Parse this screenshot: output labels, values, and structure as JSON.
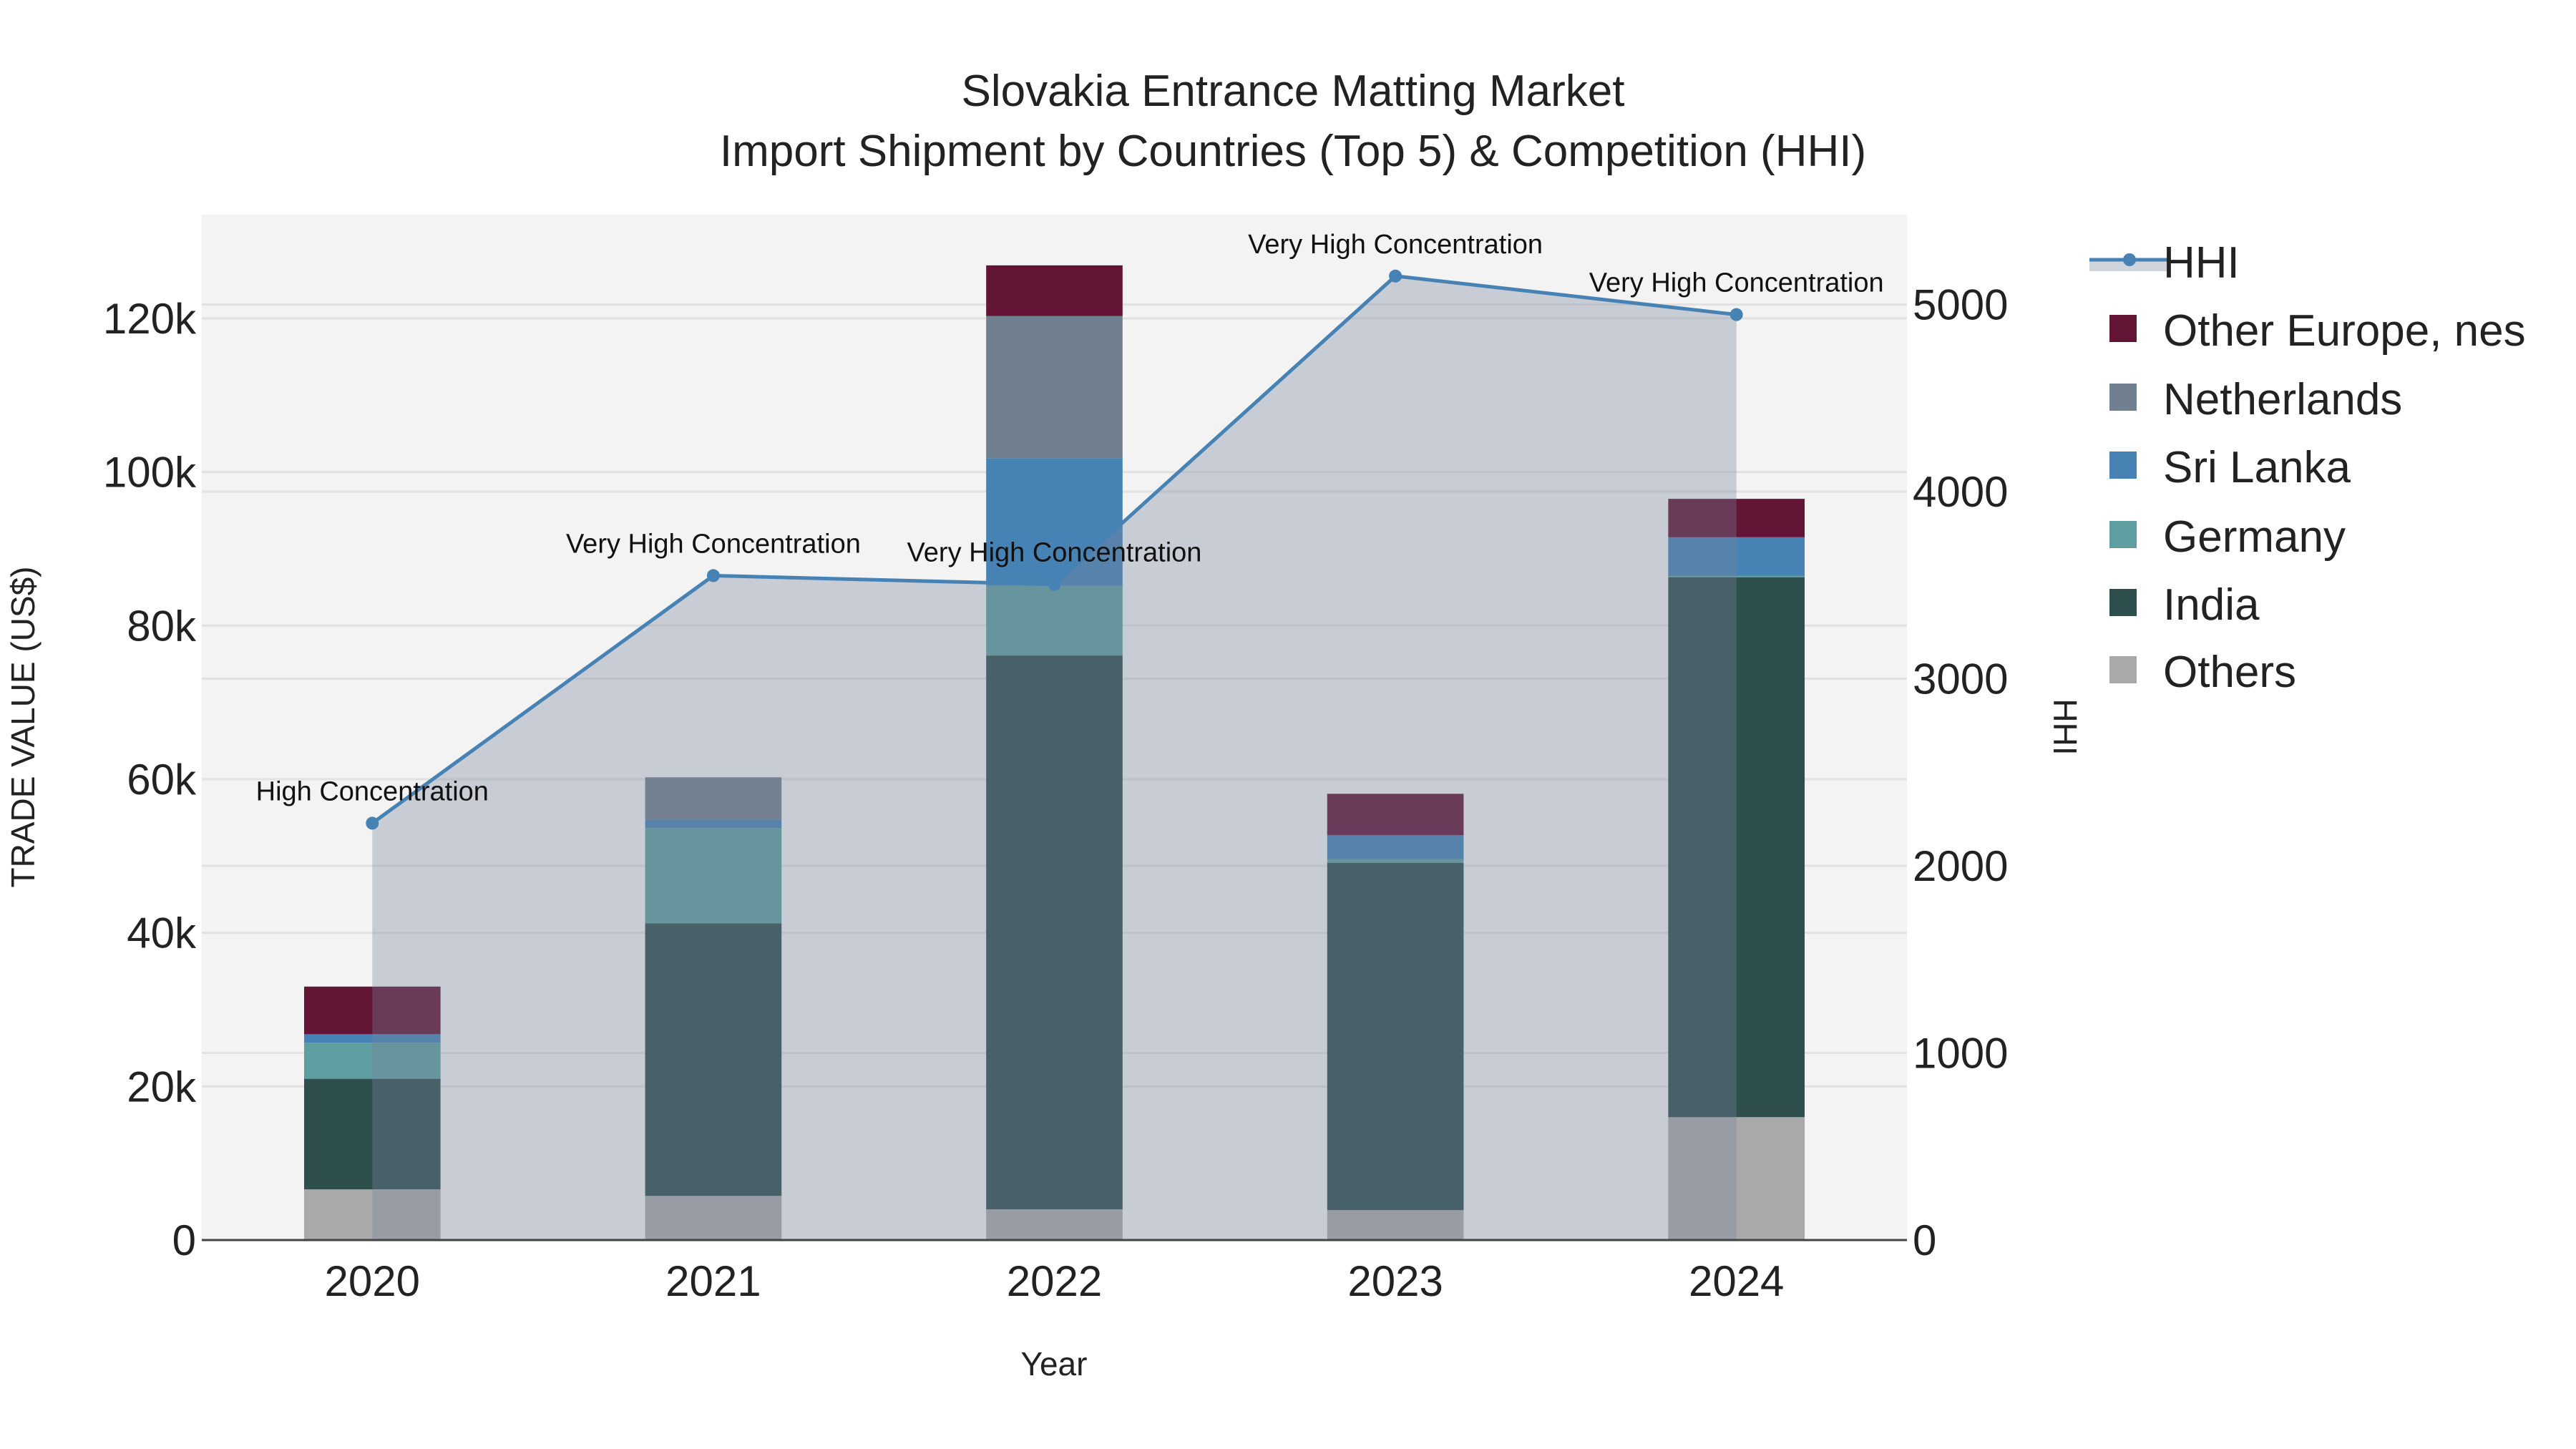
{
  "chart_data": {
    "type": "bar",
    "title": "Slovakia Entrance Matting Market",
    "subtitle": "Import Shipment by Countries (Top 5) & Competition (HHI)",
    "xlabel": "Year",
    "ylabel": "TRADE VALUE (US$)",
    "y2label": "HHI",
    "categories": [
      "2020",
      "2021",
      "2022",
      "2023",
      "2024"
    ],
    "ylim": [
      0,
      133500
    ],
    "y2lim": [
      0,
      5480
    ],
    "yticks": [
      0,
      20000,
      40000,
      60000,
      80000,
      100000,
      120000
    ],
    "yticklabels": [
      "0",
      "20k",
      "40k",
      "60k",
      "80k",
      "100k",
      "120k"
    ],
    "y2ticks": [
      0,
      1000,
      2000,
      3000,
      4000,
      5000
    ],
    "y2ticklabels": [
      "0",
      "1000",
      "2000",
      "3000",
      "4000",
      "5000"
    ],
    "stacked": true,
    "grid": true,
    "legend_position": "right",
    "series": [
      {
        "name": "Others",
        "color": "#a9a9a9",
        "values": [
          6600,
          5750,
          4000,
          3900,
          16000
        ]
      },
      {
        "name": "India",
        "color": "#2f4f4f",
        "values": [
          14400,
          35500,
          72100,
          45200,
          70300
        ]
      },
      {
        "name": "Germany",
        "color": "#5f9ea0",
        "values": [
          4700,
          12400,
          9100,
          500,
          200
        ]
      },
      {
        "name": "Sri Lanka",
        "color": "#4682b4",
        "values": [
          1100,
          1100,
          16600,
          3100,
          5000
        ]
      },
      {
        "name": "Netherlands",
        "color": "#708090",
        "values": [
          0,
          5500,
          18500,
          0,
          0
        ]
      },
      {
        "name": "Other Europe, nes",
        "color": "#631536",
        "values": [
          6200,
          0,
          6600,
          5400,
          5000
        ]
      }
    ],
    "hhi": {
      "name": "HHI",
      "color": "#4682b4",
      "values": [
        2228,
        3551,
        3504,
        5152,
        4946
      ],
      "annotations": [
        "High Concentration",
        "Very High Concentration",
        "Very High Concentration",
        "Very High Concentration",
        "Very High Concentration"
      ]
    },
    "legend_order": [
      "HHI",
      "Other Europe, nes",
      "Netherlands",
      "Sri Lanka",
      "Germany",
      "India",
      "Others"
    ]
  }
}
